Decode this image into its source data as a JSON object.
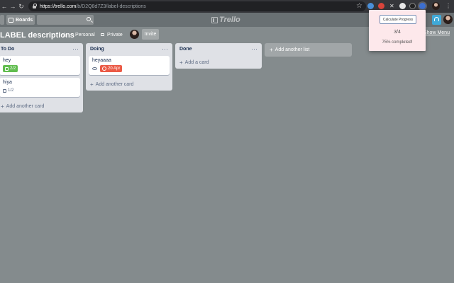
{
  "browser": {
    "url_host": "https://trello.com",
    "url_path": "/b/D2Q8d7Z3/label-descriptions",
    "back_glyph": "←",
    "forward_glyph": "→",
    "reload_glyph": "↻",
    "star_glyph": "☆",
    "menu_glyph": "⋮",
    "ext_x_glyph": "✕"
  },
  "header": {
    "boards_label": "Boards",
    "logo_text": "Trello"
  },
  "board": {
    "title": "LABEL descriptions",
    "personal_label": "Personal",
    "private_label": "Private",
    "invite_label": "Invite",
    "show_menu_label": "Show Menu",
    "star_glyph": "☆"
  },
  "lists": [
    {
      "title": "To Do",
      "menu": "···",
      "cards": [
        {
          "title": "hey",
          "badge": "2/2",
          "badge_type": "checklist-complete"
        },
        {
          "title": "hiya",
          "badge": "1/2",
          "badge_type": "checklist"
        }
      ],
      "add_label": "Add another card"
    },
    {
      "title": "Doing",
      "menu": "···",
      "cards": [
        {
          "title": "heyaaaa",
          "badge": "20 Apr",
          "badge_type": "due-overdue",
          "watching": true
        }
      ],
      "add_label": "Add another card"
    },
    {
      "title": "Done",
      "menu": "···",
      "cards": [],
      "add_label": "Add a card"
    }
  ],
  "add_list_label": "Add another list",
  "plus_glyph": "+",
  "popup": {
    "button_label": "Calculate Progress",
    "fraction": "3/4",
    "percent_text": "75% completed!"
  },
  "colors": {
    "board_bg": "#848b8d",
    "header_bg": "#697073",
    "badge_green": "#61bd4f",
    "badge_red": "#eb5a46",
    "popup_bg": "#fde8eb"
  }
}
